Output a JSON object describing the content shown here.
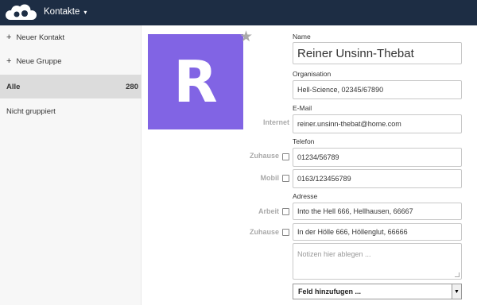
{
  "header": {
    "app_name": "Kontakte",
    "caret": "▾",
    "logo_icon": "owncloud-logo-icon"
  },
  "sidebar": {
    "new_contact": "Neuer Kontakt",
    "new_group": "Neue Gruppe",
    "plus": "+",
    "all_label": "Alle",
    "all_count": "280",
    "ungrouped": "Nicht gruppiert"
  },
  "contact": {
    "avatar_letter": "R",
    "avatar_color": "#8164e4",
    "favorite_icon": "star-icon",
    "star": "★",
    "name_label": "Name",
    "name_value": "Reiner Unsinn-Thebat",
    "org_label": "Organisation",
    "org_value": "Hell-Science, 02345/67890",
    "email_label": "E-Mail",
    "email_type": "Internet",
    "email_value": "reiner.unsinn-thebat@home.com",
    "phone_label": "Telefon",
    "phones": [
      {
        "type": "Zuhause",
        "value": "01234/56789"
      },
      {
        "type": "Mobil",
        "value": "0163/123456789"
      }
    ],
    "address_label": "Adresse",
    "addresses": [
      {
        "type": "Arbeit",
        "value": "Into the Hell 666, Hellhausen, 66667"
      },
      {
        "type": "Zuhause",
        "value": "In der Hölle 666, Höllenglut, 66666"
      }
    ],
    "notes_placeholder": "Notizen hier ablegen ...",
    "add_field_label": "Feld hinzufugen ...",
    "add_field_arrow": "▼"
  }
}
